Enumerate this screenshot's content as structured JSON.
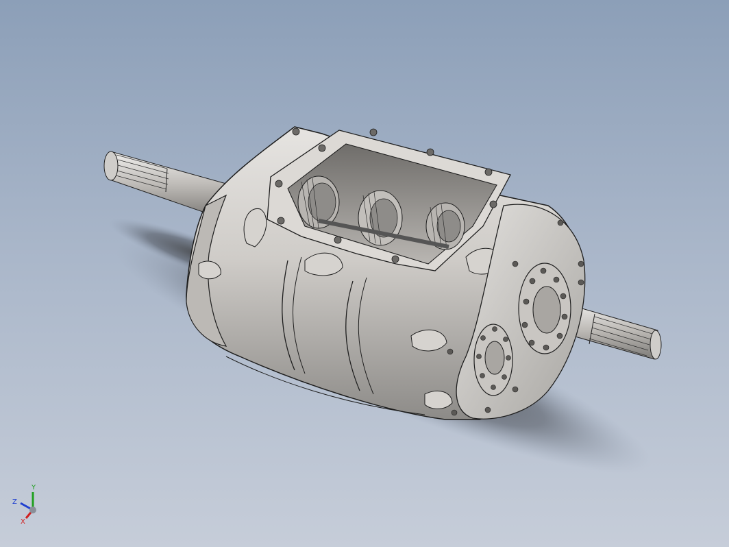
{
  "viewport": {
    "background_top": "#8c9fb8",
    "background_bottom": "#c6cdd9"
  },
  "model": {
    "kind": "gearbox-transmission-assembly",
    "body_color": "#d4d2cf",
    "edge_color": "#1e1e1e"
  },
  "triad": {
    "x_label": "X",
    "y_label": "Y",
    "z_label": "Z",
    "x_color": "#d02020",
    "y_color": "#1fa01f",
    "z_color": "#2040d0"
  }
}
